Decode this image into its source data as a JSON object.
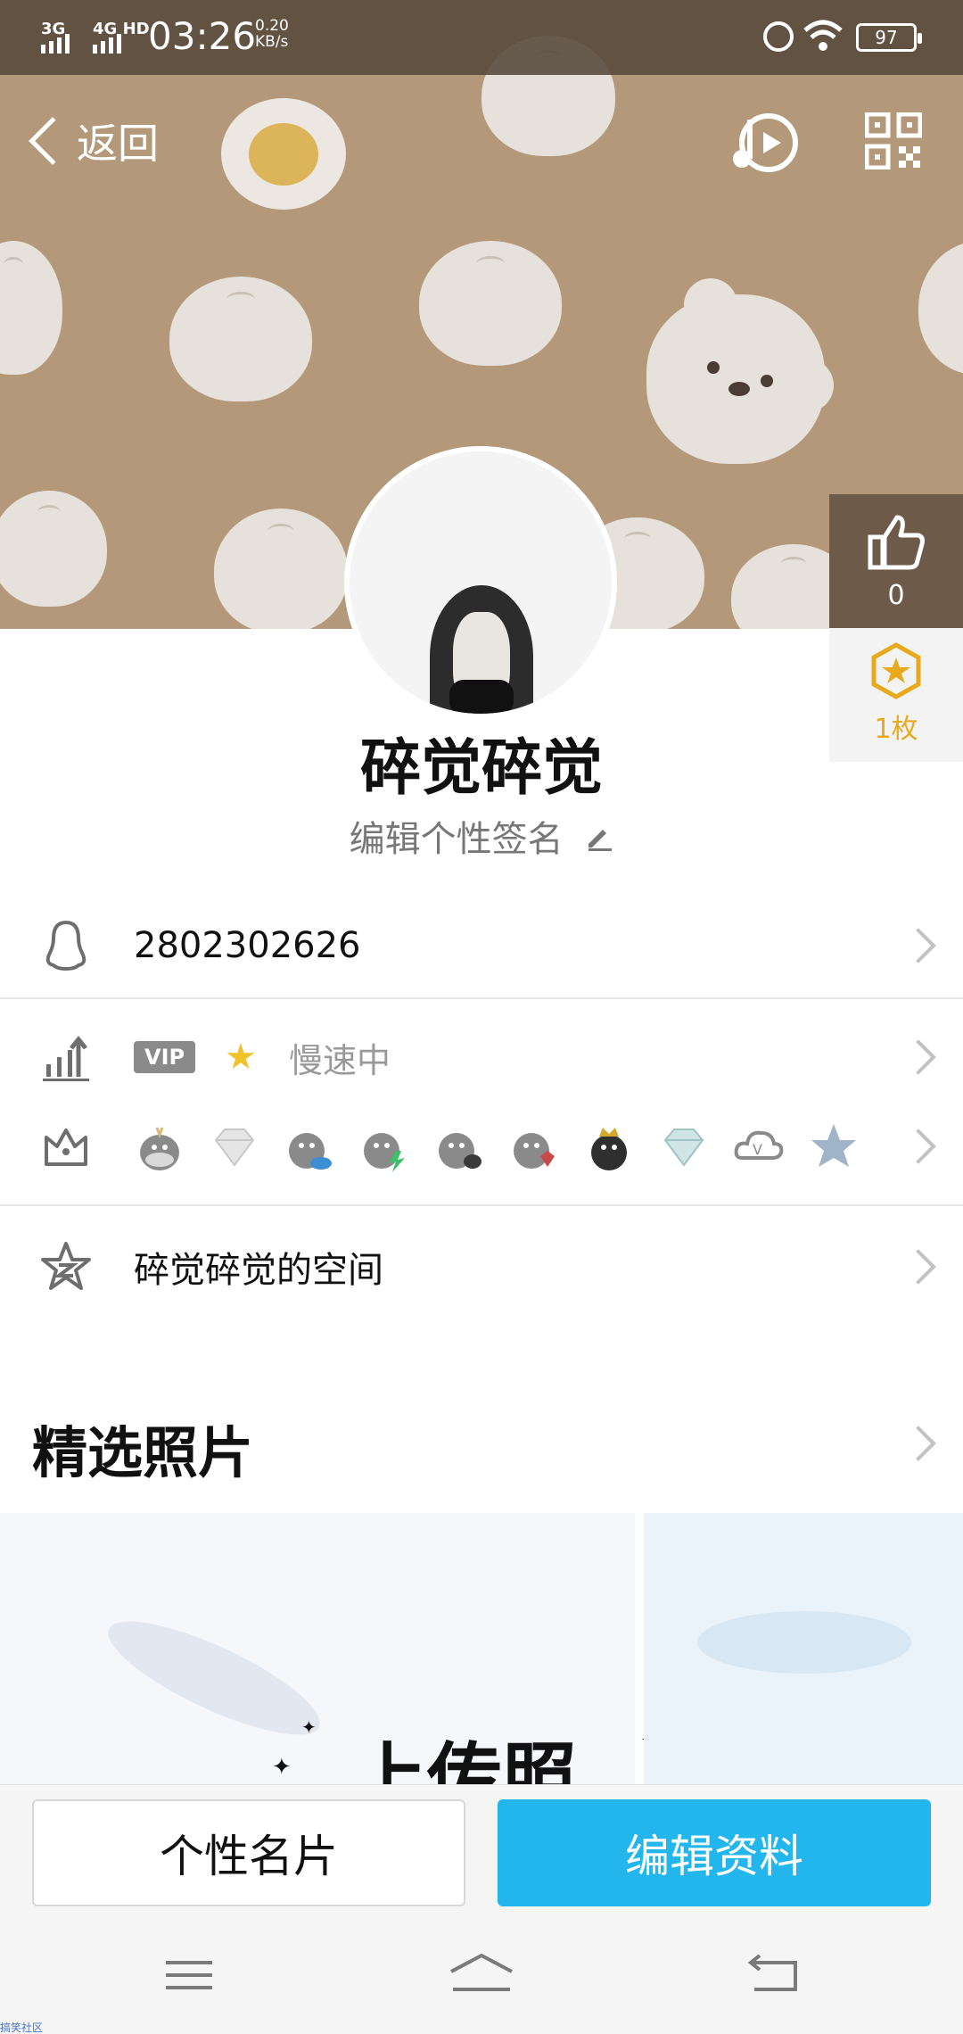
{
  "status_bar": {
    "network_1": "3G",
    "network_2": "4G HD",
    "time": "03:26",
    "speed_value": "0.20",
    "speed_unit": "KB/s",
    "battery": "97"
  },
  "header": {
    "back_label": "返回"
  },
  "profile": {
    "nickname": "碎觉碎觉",
    "signature_placeholder": "编辑个性签名",
    "likes_count": "0",
    "badge_count": "1枚"
  },
  "rows": {
    "qq_number": "2802302626",
    "vip_tag": "VIP",
    "vip_status": "慢速中",
    "space_label": "碎觉碎觉的空间"
  },
  "photos": {
    "section_title": "精选照片",
    "upload_label": "上传照片"
  },
  "actions": {
    "card_label": "个性名片",
    "edit_label": "编辑资料"
  },
  "footer": {
    "watermark": "搞笑社区"
  },
  "colors": {
    "accent": "#22b6ed",
    "cover_bg": "#b39979",
    "badge_gold": "#e8a91c"
  }
}
